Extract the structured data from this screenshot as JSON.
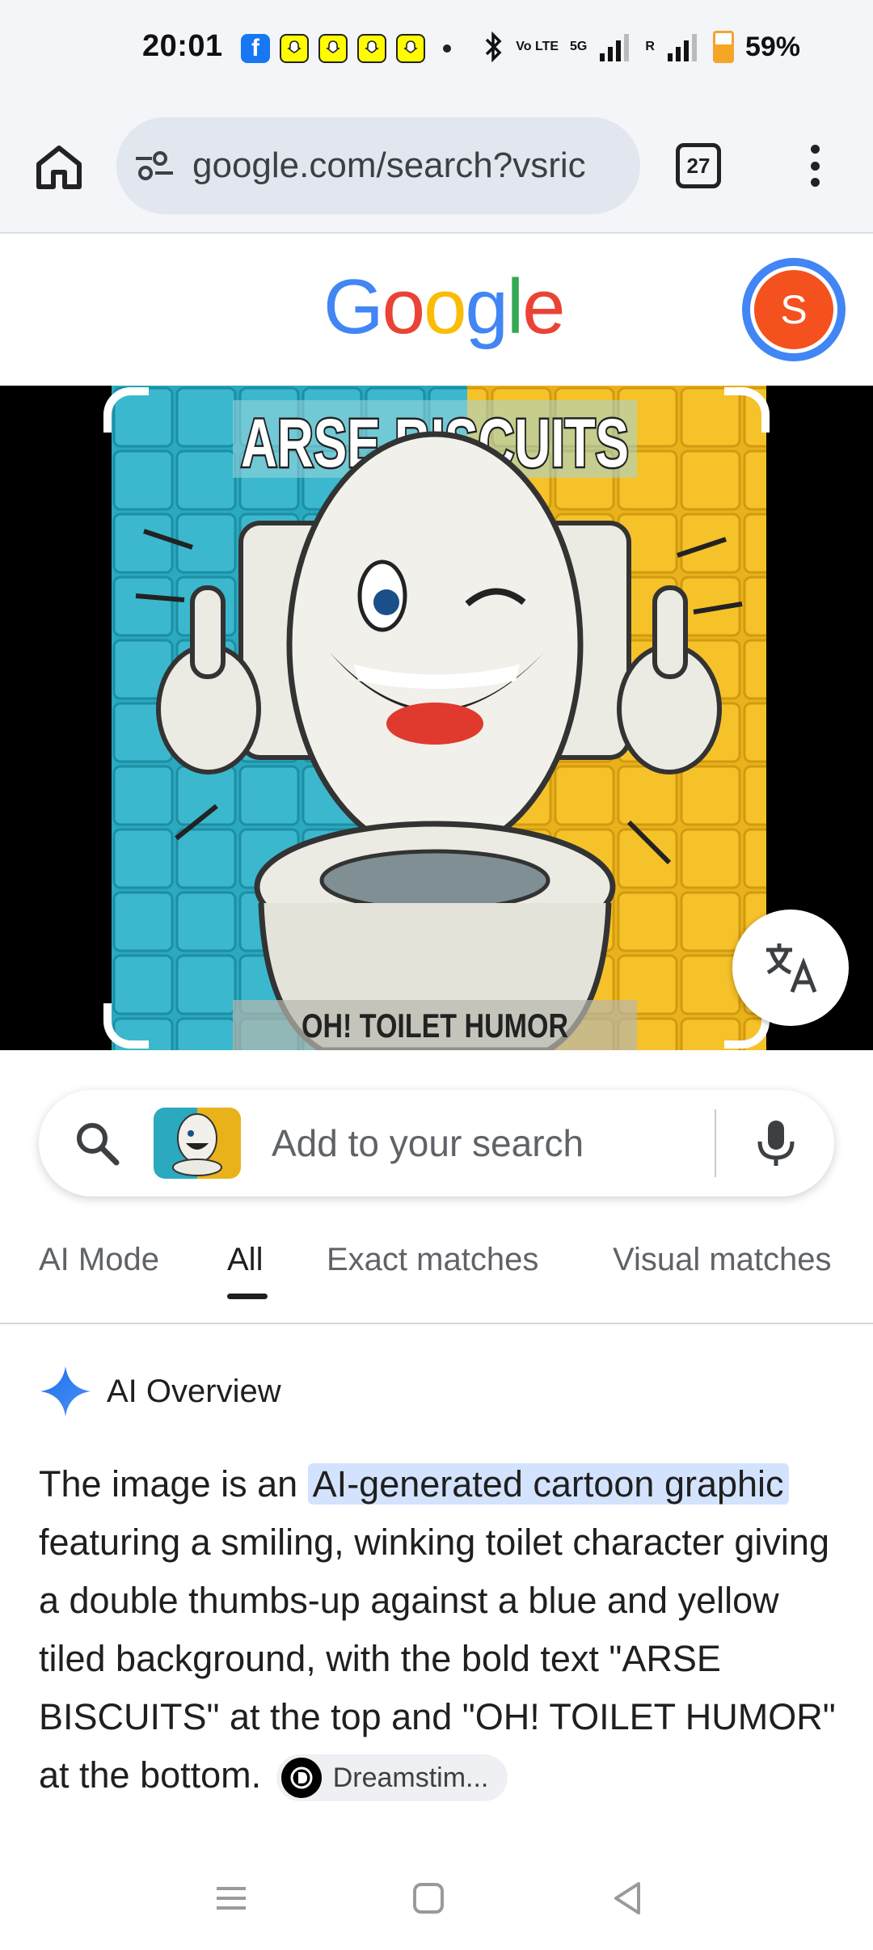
{
  "status_bar": {
    "time": "20:01",
    "network_small": "Vo LTE",
    "signal_label": "5G",
    "roaming": "R",
    "battery": "59%",
    "battery_level": 0.59,
    "notification_icons": [
      "facebook-icon",
      "snapchat-icon",
      "snapchat-icon",
      "snapchat-icon",
      "snapchat-icon"
    ]
  },
  "browser": {
    "url": "google.com/search?vsric",
    "tab_count": "27"
  },
  "google": {
    "logo_letters": [
      "G",
      "o",
      "o",
      "g",
      "l",
      "e"
    ],
    "logo_colors": [
      "#4285F4",
      "#EA4335",
      "#FBBC05",
      "#4285F4",
      "#34A853",
      "#EA4335"
    ],
    "avatar_initial": "S",
    "avatar_color": "#F4511E"
  },
  "lens_image": {
    "top_text": "ARSE BISCUITS",
    "bottom_text": "OH! TOILET HUMOR"
  },
  "search": {
    "placeholder": "Add to your search"
  },
  "tabs": [
    {
      "label": "AI Mode",
      "active": false
    },
    {
      "label": "All",
      "active": true
    },
    {
      "label": "Exact matches",
      "active": false
    },
    {
      "label": "Visual matches",
      "active": false
    }
  ],
  "ai_overview": {
    "title": "AI Overview",
    "text_before": "The image is an ",
    "highlight": "AI-generated cartoon graphic",
    "text_after": " featuring a smiling, winking toilet character giving a double thumbs-up against a blue and yellow tiled background, with the bold text \"ARSE BISCUITS\" at the top and \"OH! TOILET HUMOR\" at the bottom.",
    "source_label": "Dreamstim..."
  }
}
